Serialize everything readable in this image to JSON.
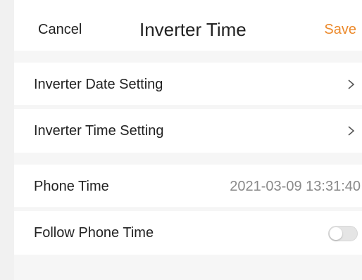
{
  "header": {
    "cancel_label": "Cancel",
    "title": "Inverter Time",
    "save_label": "Save"
  },
  "settings": {
    "date_setting_label": "Inverter Date Setting",
    "time_setting_label": "Inverter Time Setting",
    "phone_time_label": "Phone Time",
    "phone_time_value": "2021-03-09 13:31:40",
    "follow_phone_time_label": "Follow Phone Time",
    "follow_phone_time_enabled": false
  },
  "colors": {
    "accent": "#ec8a2c",
    "value_text": "#8a8a8a",
    "background": "#f6f6f6"
  },
  "icons": {
    "chevron": "chevron-right-icon"
  }
}
